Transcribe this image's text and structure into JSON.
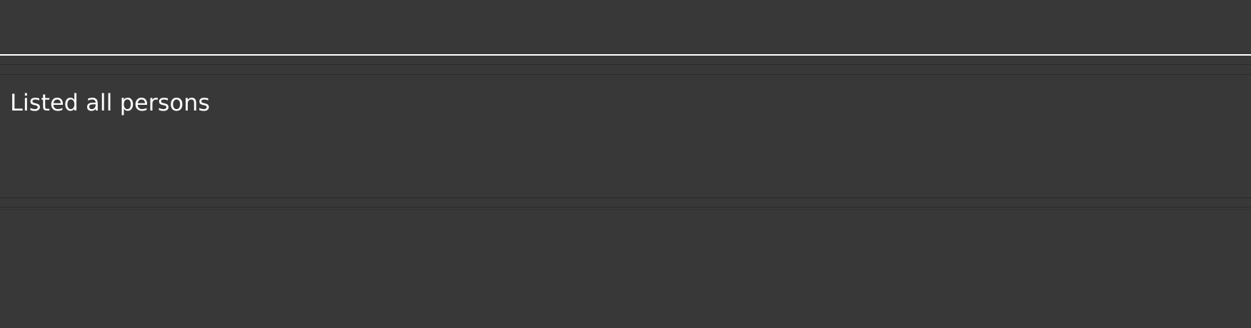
{
  "command_box": {
    "value": "",
    "placeholder": ""
  },
  "result_display": {
    "text": "Listed all persons"
  },
  "colors": {
    "background": "#383838",
    "text": "#ffffff",
    "command_underline": "#ffffff",
    "divider": "#2b2b2b"
  }
}
